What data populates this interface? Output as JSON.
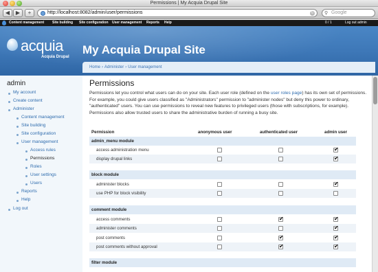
{
  "window": {
    "title": "Permissions | My Acquia Drupal Site"
  },
  "browser": {
    "url": "http://localhost:8082/admin/user/permissions",
    "search_placeholder": "Google",
    "add_tab": "+"
  },
  "admin_menu": {
    "items": [
      "Content management",
      "Site building",
      "Site configuration",
      "User management",
      "Reports",
      "Help"
    ],
    "count": "0 / 1",
    "logout": "Log out admin"
  },
  "header": {
    "logo_text": "acquia",
    "logo_sub": "Acquia Drupal",
    "site_name": "My Acquia Drupal Site"
  },
  "breadcrumb": {
    "home": "Home",
    "administer": "Administer",
    "user_management": "User management",
    "sep": "›"
  },
  "sidebar": {
    "title": "admin",
    "items": [
      "My account",
      "Create content",
      "Administer",
      "Content management",
      "Site building",
      "Site configuration",
      "User management",
      "Access rules",
      "Permissions",
      "Roles",
      "User settings",
      "Users",
      "Reports",
      "Help",
      "Log out"
    ]
  },
  "main": {
    "title": "Permissions",
    "desc_1": "Permissions let you control what users can do on your site. Each user role (defined on the ",
    "desc_link": "user roles page",
    "desc_2": ") has its own set of permissions. For example, you could give users classified as \"Administrators\" permission to \"administer nodes\" but deny this power to ordinary, \"authenticated\" users. You can use permissions to reveal new features to privileged users (those with subscriptions, for example). Permissions also allow trusted users to share the administrative burden of running a busy site."
  },
  "table": {
    "headers": [
      "Permission",
      "anonymous user",
      "authenticated user",
      "admin user"
    ],
    "modules": [
      {
        "name": "admin_menu module",
        "rows": [
          {
            "label": "access administration menu",
            "checks": [
              false,
              false,
              true
            ]
          },
          {
            "label": "display drupal links",
            "checks": [
              false,
              false,
              true
            ]
          }
        ]
      },
      {
        "name": "block module",
        "rows": [
          {
            "label": "administer blocks",
            "checks": [
              false,
              false,
              true
            ]
          },
          {
            "label": "use PHP for block visibility",
            "checks": [
              false,
              false,
              false
            ]
          }
        ]
      },
      {
        "name": "comment module",
        "rows": [
          {
            "label": "access comments",
            "checks": [
              false,
              true,
              true
            ]
          },
          {
            "label": "administer comments",
            "checks": [
              false,
              false,
              true
            ]
          },
          {
            "label": "post comments",
            "checks": [
              false,
              true,
              true
            ]
          },
          {
            "label": "post comments without approval",
            "checks": [
              false,
              true,
              true
            ]
          }
        ]
      },
      {
        "name": "filter module",
        "rows": []
      }
    ]
  }
}
